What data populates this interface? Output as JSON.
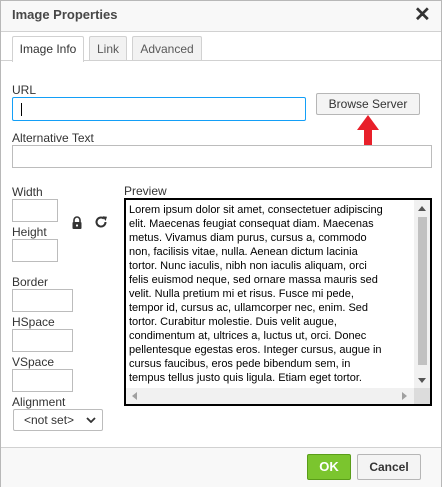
{
  "dialog": {
    "title": "Image Properties",
    "close_icon": "close-icon"
  },
  "tabs": [
    {
      "label": "Image Info",
      "active": true
    },
    {
      "label": "Link",
      "active": false
    },
    {
      "label": "Advanced",
      "active": false
    }
  ],
  "form": {
    "url_label": "URL",
    "url_value": "",
    "browse_label": "Browse Server",
    "alt_label": "Alternative Text",
    "alt_value": "",
    "width_label": "Width",
    "width_value": "",
    "height_label": "Height",
    "height_value": "",
    "lock_icon": "lock-icon",
    "reset_icon": "reset-size-icon",
    "border_label": "Border",
    "border_value": "",
    "hspace_label": "HSpace",
    "hspace_value": "",
    "vspace_label": "VSpace",
    "vspace_value": "",
    "alignment_label": "Alignment",
    "alignment_value": "<not set>"
  },
  "preview": {
    "label": "Preview",
    "lines": [
      "Lorem ipsum dolor sit amet, consectetuer adipiscing",
      "elit. Maecenas feugiat consequat diam. Maecenas",
      "metus. Vivamus diam purus, cursus a, commodo",
      "non, facilisis vitae, nulla. Aenean dictum lacinia",
      "tortor. Nunc iaculis, nibh non iaculis aliquam, orci",
      "felis euismod neque, sed ornare massa mauris sed",
      "velit. Nulla pretium mi et risus. Fusce mi pede,",
      "tempor id, cursus ac, ullamcorper nec, enim. Sed",
      "tortor. Curabitur molestie. Duis velit augue,",
      "condimentum at, ultrices a, luctus ut, orci. Donec",
      "pellentesque egestas eros. Integer cursus, augue in",
      "cursus faucibus, eros pede bibendum sem, in",
      "tempus tellus justo quis ligula. Etiam eget tortor."
    ]
  },
  "footer": {
    "ok_label": "OK",
    "cancel_label": "Cancel"
  },
  "colors": {
    "ok_green": "#7bc52e",
    "focus_blue": "#139ff7",
    "annotation_arrow": "#e8202a"
  }
}
